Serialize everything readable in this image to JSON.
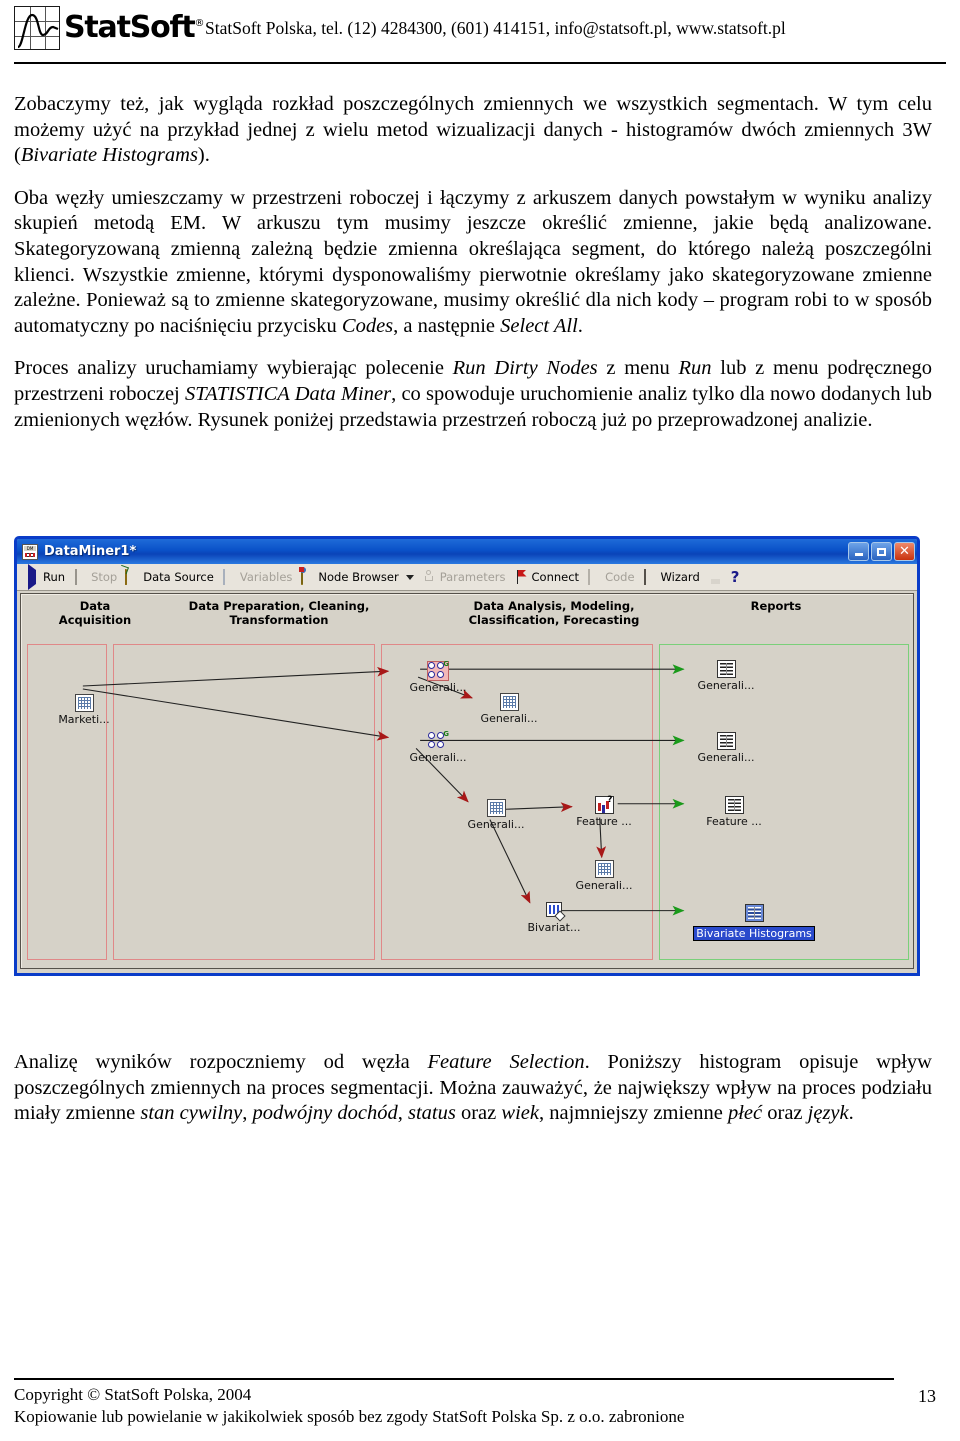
{
  "header": {
    "logo_text": "StatSoft",
    "logo_registered": "®",
    "contact": "StatSoft Polska, tel. (12) 4284300, (601) 414151, info@statsoft.pl, www.statsoft.pl"
  },
  "body": {
    "p1_a": "Zobaczymy też, jak wygląda rozkład poszczególnych zmiennych we wszystkich segmentach. W tym celu możemy użyć na przykład jednej z wielu metod wizualizacji danych - histogramów dwóch zmiennych 3W (",
    "p1_i": "Bivariate Histograms",
    "p1_b": ").",
    "p2_a": "Oba węzły umieszczamy w przestrzeni roboczej i łączymy z arkuszem danych powstałym w wyniku analizy skupień metodą EM. W arkuszu tym musimy jeszcze określić zmienne, jakie będą analizowane. Skategoryzowaną zmienną zależną będzie zmienna określająca segment, do którego należą poszczególni klienci. Wszystkie zmienne, którymi dysponowaliśmy pierwotnie określamy jako skategoryzowane zmienne zależne. Ponieważ są to zmienne skategoryzowane, musimy określić dla nich kody – program robi to w sposób automatyczny po naciśnięciu przycisku ",
    "p2_i1": "Codes",
    "p2_b": ", a następnie ",
    "p2_i2": "Select All",
    "p2_c": ".",
    "p3_a": "Proces analizy uruchamiamy wybierając polecenie ",
    "p3_i1": "Run Dirty Nodes",
    "p3_b": " z menu ",
    "p3_i2": "Run",
    "p3_c": " lub z menu podręcznego przestrzeni roboczej ",
    "p3_i3": "STATISTICA Data Miner",
    "p3_d": ", co spowoduje uruchomienie analiz tylko dla nowo dodanych lub zmienionych węzłów. Rysunek poniżej przedstawia przestrzeń roboczą już po przeprowadzonej analizie.",
    "p4_a": "Analizę wyników rozpoczniemy od węzła ",
    "p4_i1": "Feature Selection",
    "p4_b": ". Poniższy histogram opisuje wpływ poszczególnych zmiennych na proces segmentacji. Można zauważyć, że największy wpływ na proces podziału miały zmienne ",
    "p4_i2": "stan cywilny",
    "p4_c": ", ",
    "p4_i3": "podwójny dochód",
    "p4_d": ", ",
    "p4_i4": "status",
    "p4_e": " oraz ",
    "p4_i5": "wiek",
    "p4_f": ", najmniejszy zmienne ",
    "p4_i6": "płeć",
    "p4_g": " oraz ",
    "p4_i7": "język",
    "p4_h": "."
  },
  "figure": {
    "window_title": "DataMiner1*",
    "window_buttons": {
      "minimize": "minimize",
      "maximize": "maximize",
      "close": "close"
    },
    "toolbar": [
      {
        "label": "Run",
        "icon": "run-icon",
        "enabled": true,
        "dropdown": false
      },
      {
        "label": "Stop",
        "icon": "stop-icon",
        "enabled": false,
        "dropdown": false
      },
      {
        "label": "Data Source",
        "icon": "folder-icon",
        "enabled": true,
        "dropdown": false
      },
      {
        "label": "Variables",
        "icon": "variables-icon",
        "enabled": false,
        "dropdown": false
      },
      {
        "label": "Node Browser",
        "icon": "node-browser-icon",
        "enabled": true,
        "dropdown": true
      },
      {
        "label": "Parameters",
        "icon": "parameters-icon",
        "enabled": false,
        "dropdown": false
      },
      {
        "label": "Connect",
        "icon": "connect-flag-icon",
        "enabled": true,
        "dropdown": false
      },
      {
        "label": "Code",
        "icon": "code-icon",
        "enabled": false,
        "dropdown": false
      },
      {
        "label": "Wizard",
        "icon": "wizard-icon",
        "enabled": true,
        "dropdown": false
      },
      {
        "label": "",
        "icon": "save-icon",
        "enabled": true,
        "dropdown": false
      },
      {
        "label": "?",
        "icon": "help-icon",
        "enabled": true,
        "dropdown": false
      }
    ],
    "columns": [
      {
        "line1": "Data",
        "line2": "Acquisition"
      },
      {
        "line1": "Data Preparation, Cleaning,",
        "line2": "Transformation"
      },
      {
        "line1": "Data Analysis, Modeling,",
        "line2": "Classification, Forecasting"
      },
      {
        "line1": "Reports",
        "line2": ""
      }
    ],
    "nodes": [
      {
        "id": "marketing",
        "label": "Marketi...",
        "icon": "spreadsheet-icon",
        "selected": false
      },
      {
        "id": "gen1",
        "label": "Generali...",
        "icon": "cluster-icon",
        "selected": true
      },
      {
        "id": "gen1sheet",
        "label": "Generali...",
        "icon": "spreadsheet-icon",
        "selected": false
      },
      {
        "id": "gen2",
        "label": "Generali...",
        "icon": "cluster-icon",
        "selected": false
      },
      {
        "id": "gen2sheet",
        "label": "Generali...",
        "icon": "spreadsheet-icon",
        "selected": false
      },
      {
        "id": "feature",
        "label": "Feature ...",
        "icon": "feature-selection-icon",
        "selected": false
      },
      {
        "id": "featsheet",
        "label": "Generali...",
        "icon": "spreadsheet-icon",
        "selected": false
      },
      {
        "id": "bivariate",
        "label": "Bivariat...",
        "icon": "bivariate-icon",
        "selected": false
      },
      {
        "id": "rep1",
        "label": "Generali...",
        "icon": "report-icon",
        "selected": false
      },
      {
        "id": "rep2",
        "label": "Generali...",
        "icon": "report-icon",
        "selected": false
      },
      {
        "id": "rep3",
        "label": "Feature ...",
        "icon": "report-icon",
        "selected": false
      },
      {
        "id": "rep4",
        "label": "Bivariate Histograms",
        "icon": "report-icon",
        "selected": true
      }
    ]
  },
  "footer": {
    "line1": "Copyright © StatSoft Polska, 2004",
    "line2": "Kopiowanie lub powielanie w jakikolwiek sposób bez zgody StatSoft Polska Sp. z o.o. zabronione",
    "page_number": "13"
  }
}
